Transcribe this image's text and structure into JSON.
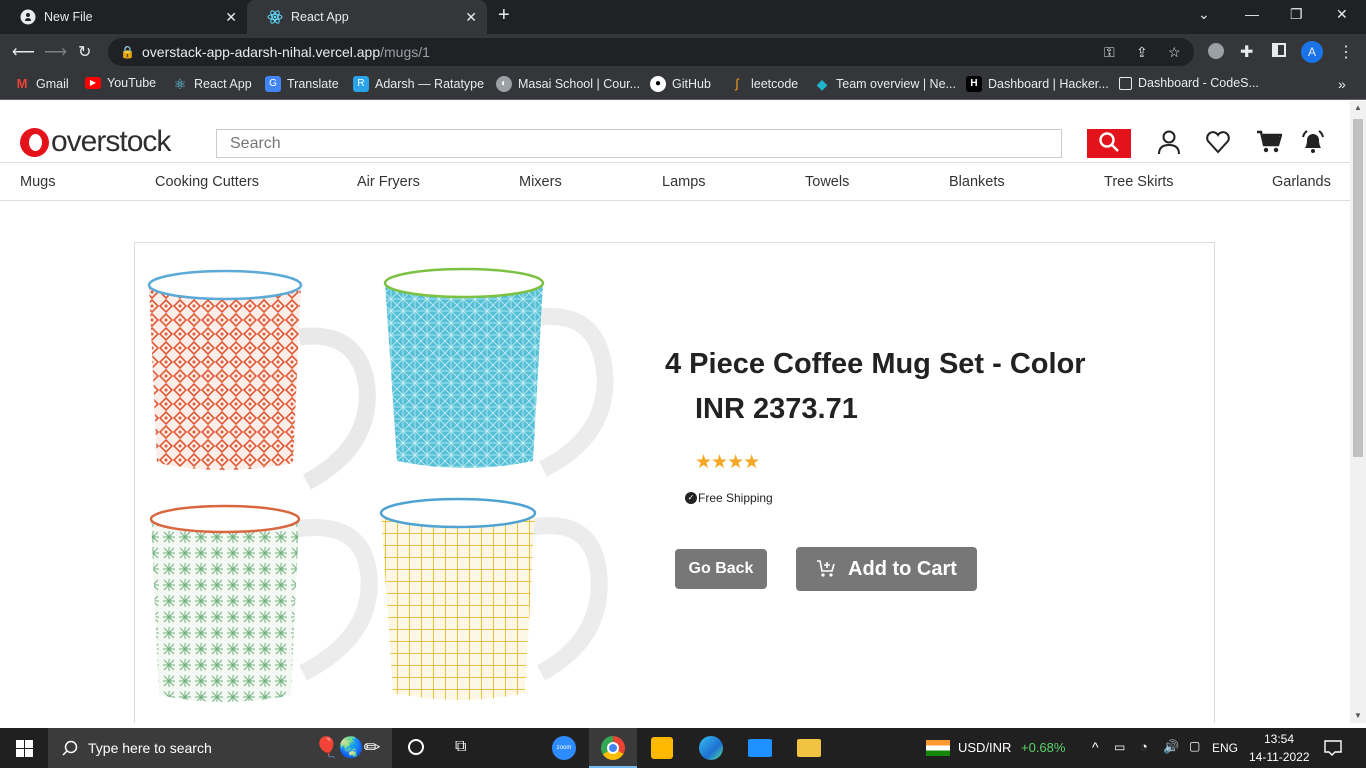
{
  "browser": {
    "tabs": [
      {
        "title": "New File",
        "icon": "github-icon"
      },
      {
        "title": "React App",
        "icon": "react-icon"
      }
    ],
    "url_host": "overstack-app-adarsh-nihal.vercel.app",
    "url_path": "/mugs/1",
    "profile_initial": "A",
    "bookmarks": [
      {
        "label": "Gmail",
        "icon": "gmail-icon",
        "color": "#ea4335"
      },
      {
        "label": "YouTube",
        "icon": "youtube-icon",
        "color": "#ff0000"
      },
      {
        "label": "React App",
        "icon": "react-icon",
        "color": "#61dafb"
      },
      {
        "label": "Translate",
        "icon": "translate-icon",
        "color": "#4285f4"
      },
      {
        "label": "Adarsh — Ratatype",
        "icon": "ratatype-icon",
        "color": "#2aa3e8"
      },
      {
        "label": "Masai School | Cour...",
        "icon": "masai-icon",
        "color": "#9aa0a6"
      },
      {
        "label": "GitHub",
        "icon": "github-icon",
        "color": "#ffffff"
      },
      {
        "label": "leetcode",
        "icon": "leetcode-icon",
        "color": "#f89f1b"
      },
      {
        "label": "Team overview | Ne...",
        "icon": "diamond-icon",
        "color": "#1fb5c9"
      },
      {
        "label": "Dashboard | Hacker...",
        "icon": "hackerrank-icon",
        "color": "#000000"
      },
      {
        "label": "Dashboard - CodeS...",
        "icon": "page-icon",
        "color": "#35363a"
      }
    ]
  },
  "site": {
    "logo_text": "overstock",
    "search_placeholder": "Search",
    "brand_color": "#e4121b",
    "nav": [
      "Mugs",
      "Cooking Cutters",
      "Air Fryers",
      "Mixers",
      "Lamps",
      "Towels",
      "Blankets",
      "Tree Skirts",
      "Garlands"
    ]
  },
  "product": {
    "title": "4 Piece Coffee Mug Set - Color",
    "price": "INR 2373.71",
    "rating": 4,
    "shipping": "Free Shipping",
    "back_label": "Go Back",
    "cart_label": "Add to Cart"
  },
  "taskbar": {
    "search_placeholder": "Type here to search",
    "ticker": "USD/INR",
    "ticker_change": "+0.68%",
    "language": "ENG",
    "time": "13:54",
    "date": "14-11-2022"
  }
}
